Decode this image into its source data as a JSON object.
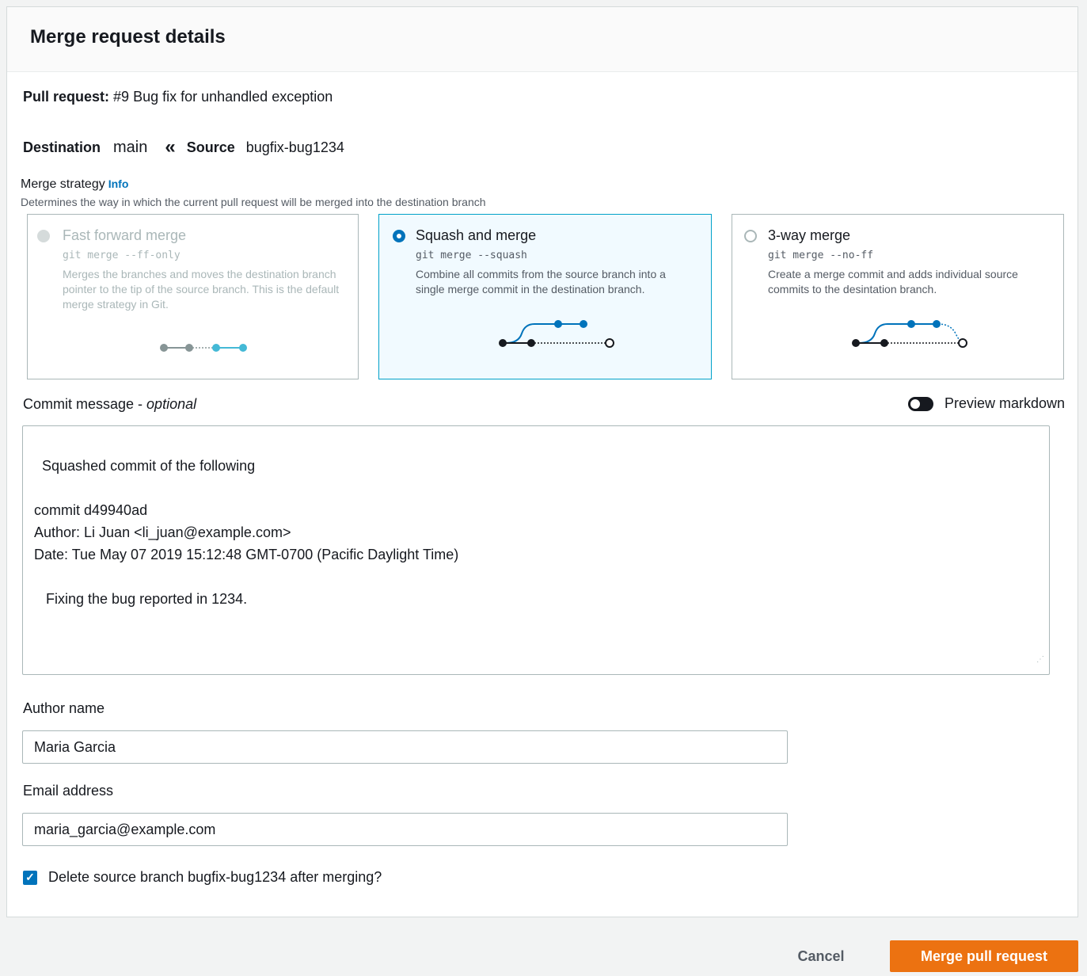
{
  "panel": {
    "title": "Merge request details"
  },
  "pull_request": {
    "label": "Pull request:",
    "value": "#9 Bug fix for unhandled exception"
  },
  "branches": {
    "destination_label": "Destination",
    "destination_value": "main",
    "arrow": "«",
    "source_label": "Source",
    "source_value": "bugfix-bug1234"
  },
  "merge_strategy": {
    "label": "Merge strategy",
    "info": "Info",
    "description": "Determines the way in which the current pull request will be merged into the destination branch",
    "selected": "Squash and merge",
    "options": [
      {
        "title": "Fast forward merge",
        "code": "git merge --ff-only",
        "description": "Merges the branches and moves the destination branch pointer to the tip of the source branch. This is the default merge strategy in Git.",
        "state": "disabled"
      },
      {
        "title": "Squash and merge",
        "code": "git merge --squash",
        "description": "Combine all commits from the source branch into a single merge commit in the destination branch.",
        "state": "selected"
      },
      {
        "title": "3-way merge",
        "code": "git merge --no-ff",
        "description": "Create a merge commit and adds individual source commits to the desintation branch.",
        "state": "unselected"
      }
    ]
  },
  "commit_message": {
    "label": "Commit message",
    "optional": "optional",
    "separator": " - ",
    "preview_toggle_label": "Preview markdown",
    "value": "Squashed commit of the following\n\ncommit d49940ad\nAuthor: Li Juan <li_juan@example.com>\nDate: Tue May 07 2019 15:12:48 GMT-0700 (Pacific Daylight Time)\n\n   Fixing the bug reported in 1234."
  },
  "author": {
    "label": "Author name",
    "value": "Maria Garcia"
  },
  "email": {
    "label": "Email address",
    "value": "maria_garcia@example.com"
  },
  "delete_branch": {
    "label": "Delete source branch bugfix-bug1234 after merging?",
    "checked": true
  },
  "footer": {
    "cancel": "Cancel",
    "merge": "Merge pull request"
  },
  "colors": {
    "accent": "#0073bb",
    "primary_button": "#ec7211",
    "selected_card_bg": "#f1faff"
  },
  "icons": {
    "checkbox": "check-icon",
    "toggle": "toggle-off-icon"
  }
}
